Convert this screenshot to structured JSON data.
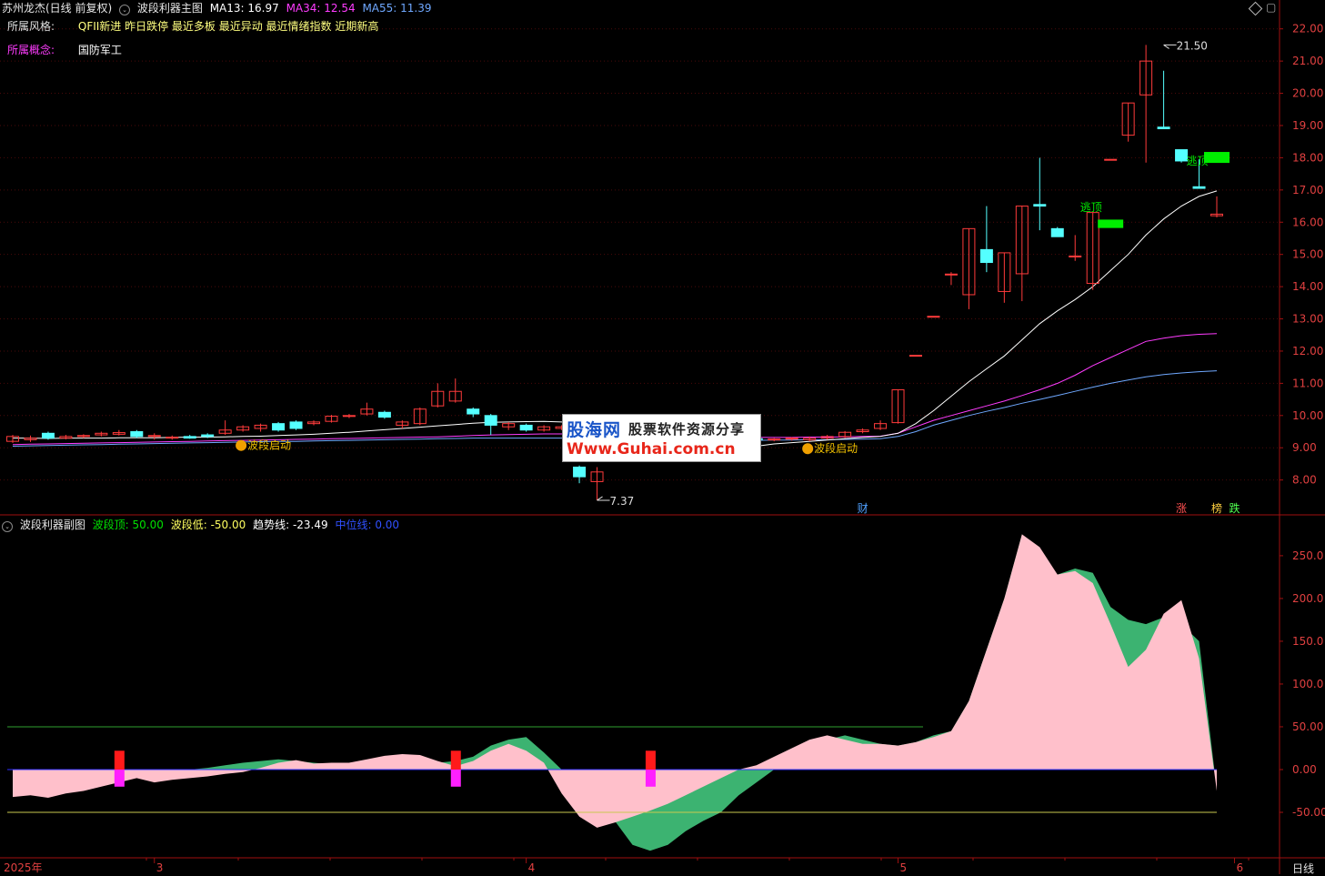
{
  "main_header": {
    "stock": "苏州龙杰(日线 前复权)",
    "indicator": "波段利器主图",
    "ma13": "MA13: 16.97",
    "ma34": "MA34: 12.54",
    "ma55": "MA55: 11.39"
  },
  "info": {
    "style_label": "所属风格:",
    "style_value": "QFII新进 昨日跌停 最近多板 最近异动 最近情绪指数 近期新高",
    "concept_label": "所属概念:",
    "concept_value": "国防军工"
  },
  "sub_header": {
    "indicator": "波段利器副图",
    "top": "波段顶: 50.00",
    "low": "波段低: -50.00",
    "trend": "趋势线: -23.49",
    "mid": "中位线: 0.00"
  },
  "logo": {
    "brand": "股海网",
    "slogan": "股票软件资源分享",
    "url": "Www.Guhai.com.cn"
  },
  "period_label": "日线",
  "colors": {
    "background": "#000000",
    "up": "#ff3b3b",
    "down": "#54ffff",
    "ma13": "#ffffff",
    "ma34": "#ff3cff",
    "ma55": "#6fa8ff",
    "pink_area": "#ffc0cb",
    "green_area": "#3cb371",
    "signal_green": "#00ee00",
    "bo_line": "#2fa02f",
    "low_line": "#c8c850",
    "mid_line": "#3030ff"
  },
  "chart_data": [
    {
      "type": "candlestick",
      "title": "波段利器主图",
      "ylim": [
        7.2,
        22.5
      ],
      "y_ticks": [
        "8.00",
        "9.00",
        "10.00",
        "11.00",
        "12.00",
        "13.00",
        "14.00",
        "15.00",
        "16.00",
        "17.00",
        "18.00",
        "19.00",
        "20.00",
        "21.00",
        "22.00"
      ],
      "x_labels": [
        "2025年",
        "3",
        "4",
        "5",
        "6"
      ],
      "x_label_index": [
        0,
        8,
        29,
        50,
        69
      ],
      "candles": [
        [
          9.2,
          9.35,
          9.15,
          9.4
        ],
        [
          9.25,
          9.3,
          9.18,
          9.38
        ],
        [
          9.45,
          9.3,
          9.25,
          9.5
        ],
        [
          9.3,
          9.35,
          9.26,
          9.4
        ],
        [
          9.35,
          9.38,
          9.3,
          9.42
        ],
        [
          9.4,
          9.45,
          9.35,
          9.5
        ],
        [
          9.42,
          9.47,
          9.38,
          9.55
        ],
        [
          9.5,
          9.35,
          9.3,
          9.55
        ],
        [
          9.35,
          9.38,
          9.25,
          9.45
        ],
        [
          9.3,
          9.33,
          9.25,
          9.38
        ],
        [
          9.35,
          9.3,
          9.28,
          9.4
        ],
        [
          9.4,
          9.35,
          9.3,
          9.45
        ],
        [
          9.45,
          9.55,
          9.4,
          9.85
        ],
        [
          9.55,
          9.65,
          9.5,
          9.7
        ],
        [
          9.6,
          9.7,
          9.5,
          9.75
        ],
        [
          9.75,
          9.55,
          9.5,
          9.8
        ],
        [
          9.8,
          9.6,
          9.55,
          9.85
        ],
        [
          9.75,
          9.8,
          9.7,
          9.85
        ],
        [
          9.82,
          9.98,
          9.78,
          10.02
        ],
        [
          9.98,
          10.0,
          9.92,
          10.05
        ],
        [
          10.05,
          10.2,
          10.0,
          10.4
        ],
        [
          10.1,
          9.95,
          9.9,
          10.15
        ],
        [
          9.7,
          9.8,
          9.6,
          9.85
        ],
        [
          9.75,
          10.2,
          9.7,
          10.25
        ],
        [
          10.3,
          10.75,
          10.25,
          11.0
        ],
        [
          10.45,
          10.75,
          10.4,
          11.15
        ],
        [
          10.2,
          10.05,
          9.95,
          10.25
        ],
        [
          10.0,
          9.7,
          9.4,
          10.05
        ],
        [
          9.65,
          9.75,
          9.55,
          9.8
        ],
        [
          9.7,
          9.55,
          9.5,
          9.75
        ],
        [
          9.55,
          9.65,
          9.5,
          9.7
        ],
        [
          9.6,
          9.65,
          9.55,
          9.7
        ],
        [
          8.4,
          8.1,
          7.9,
          8.45
        ],
        [
          7.95,
          8.25,
          7.37,
          8.4
        ],
        [
          9.3,
          9.15,
          9.1,
          9.35
        ],
        [
          9.15,
          9.2,
          9.05,
          9.25
        ],
        [
          9.25,
          9.3,
          9.15,
          9.35
        ],
        [
          9.3,
          9.25,
          9.2,
          9.35
        ],
        [
          9.28,
          9.32,
          9.22,
          9.4
        ],
        [
          9.3,
          9.35,
          9.25,
          9.4
        ],
        [
          9.35,
          9.3,
          9.25,
          9.4
        ],
        [
          9.3,
          9.28,
          9.2,
          9.35
        ],
        [
          9.28,
          9.25,
          9.2,
          9.32
        ],
        [
          9.25,
          9.27,
          9.2,
          9.3
        ],
        [
          9.27,
          9.3,
          9.22,
          9.33
        ],
        [
          9.25,
          9.3,
          9.2,
          9.35
        ],
        [
          9.3,
          9.35,
          9.25,
          9.4
        ],
        [
          9.35,
          9.48,
          9.3,
          9.52
        ],
        [
          9.5,
          9.55,
          9.45,
          9.6
        ],
        [
          9.6,
          9.75,
          9.55,
          9.85
        ],
        [
          9.78,
          10.8,
          9.75,
          10.8
        ],
        [
          11.87,
          11.87,
          11.87,
          11.87
        ],
        [
          13.08,
          13.08,
          13.08,
          13.08
        ],
        [
          14.39,
          14.39,
          14.05,
          14.45
        ],
        [
          13.75,
          15.8,
          13.3,
          15.8
        ],
        [
          15.15,
          14.75,
          14.45,
          16.5
        ],
        [
          13.85,
          15.05,
          13.5,
          15.05
        ],
        [
          14.4,
          16.5,
          13.55,
          16.5
        ],
        [
          16.55,
          16.5,
          15.75,
          18.0
        ],
        [
          15.8,
          15.55,
          15.55,
          15.85
        ],
        [
          14.95,
          14.95,
          14.8,
          15.6
        ],
        [
          14.1,
          16.3,
          13.9,
          16.3
        ],
        [
          17.95,
          17.95,
          17.95,
          17.95
        ],
        [
          18.7,
          19.7,
          18.5,
          19.7
        ],
        [
          19.95,
          21.0,
          17.85,
          21.5
        ],
        [
          18.95,
          18.9,
          18.9,
          20.7
        ],
        [
          18.25,
          17.9,
          17.85,
          18.25
        ],
        [
          17.1,
          17.05,
          17.05,
          17.95
        ],
        [
          16.2,
          16.25,
          16.15,
          16.8
        ]
      ],
      "ma13": [
        9.3,
        9.3,
        9.29,
        9.3,
        9.3,
        9.3,
        9.31,
        9.31,
        9.31,
        9.32,
        9.33,
        9.33,
        9.34,
        9.35,
        9.36,
        9.38,
        9.4,
        9.42,
        9.45,
        9.48,
        9.52,
        9.56,
        9.6,
        9.64,
        9.68,
        9.72,
        9.76,
        9.79,
        9.8,
        9.81,
        9.82,
        9.8,
        9.7,
        9.55,
        9.4,
        9.2,
        9.0,
        8.9,
        8.85,
        8.87,
        8.92,
        8.98,
        9.05,
        9.12,
        9.16,
        9.2,
        9.24,
        9.28,
        9.32,
        9.35,
        9.45,
        9.75,
        10.15,
        10.6,
        11.05,
        11.45,
        11.85,
        12.35,
        12.85,
        13.25,
        13.6,
        14.0,
        14.5,
        15.0,
        15.6,
        16.1,
        16.5,
        16.8,
        16.97
      ],
      "ma34": [
        9.1,
        9.11,
        9.12,
        9.13,
        9.14,
        9.15,
        9.16,
        9.17,
        9.18,
        9.19,
        9.2,
        9.21,
        9.22,
        9.23,
        9.24,
        9.25,
        9.26,
        9.27,
        9.28,
        9.29,
        9.3,
        9.31,
        9.32,
        9.33,
        9.34,
        9.36,
        9.38,
        9.4,
        9.41,
        9.42,
        9.43,
        9.43,
        9.42,
        9.4,
        9.38,
        9.37,
        9.36,
        9.35,
        9.34,
        9.33,
        9.32,
        9.32,
        9.32,
        9.32,
        9.32,
        9.33,
        9.33,
        9.34,
        9.35,
        9.36,
        9.45,
        9.65,
        9.85,
        10.0,
        10.15,
        10.3,
        10.45,
        10.62,
        10.8,
        11.0,
        11.25,
        11.55,
        11.8,
        12.05,
        12.3,
        12.4,
        12.48,
        12.52,
        12.54
      ],
      "ma55": [
        9.05,
        9.06,
        9.07,
        9.08,
        9.09,
        9.1,
        9.11,
        9.12,
        9.13,
        9.14,
        9.15,
        9.16,
        9.17,
        9.18,
        9.19,
        9.2,
        9.2,
        9.21,
        9.22,
        9.23,
        9.24,
        9.25,
        9.26,
        9.27,
        9.28,
        9.29,
        9.3,
        9.3,
        9.3,
        9.3,
        9.3,
        9.3,
        9.29,
        9.28,
        9.27,
        9.26,
        9.25,
        9.24,
        9.24,
        9.23,
        9.23,
        9.23,
        9.23,
        9.24,
        9.24,
        9.25,
        9.25,
        9.26,
        9.27,
        9.28,
        9.35,
        9.5,
        9.7,
        9.85,
        10.0,
        10.13,
        10.25,
        10.38,
        10.5,
        10.62,
        10.75,
        10.88,
        11.0,
        11.1,
        11.2,
        11.27,
        11.32,
        11.36,
        11.39
      ],
      "annotations": [
        {
          "index": 13,
          "price": 9.1,
          "text": "波段启动"
        },
        {
          "index": 45,
          "price": 9.0,
          "text": "波段启动"
        },
        {
          "index": 61,
          "price": 16.2,
          "text": "逃顶"
        },
        {
          "index": 67,
          "price": 17.65,
          "text": "逃顶"
        },
        {
          "index": 33,
          "price": 7.37,
          "text": "7.37",
          "kind": "min"
        },
        {
          "index": 65,
          "price": 21.5,
          "text": "21.50",
          "kind": "max"
        }
      ],
      "signal_boxes": [
        {
          "index": 62,
          "low": 15.82,
          "high": 16.08
        },
        {
          "index": 68,
          "low": 17.84,
          "high": 18.18
        }
      ],
      "event_tags": [
        {
          "index": 48,
          "text": "财"
        },
        {
          "index": 66,
          "text": "涨"
        },
        {
          "index": 68,
          "text": "榜"
        },
        {
          "index": 69,
          "text": "跌"
        }
      ]
    },
    {
      "type": "area",
      "title": "波段利器副图",
      "ylim": [
        -100,
        285
      ],
      "y_ticks": [
        "250.0",
        "200.0",
        "150.0",
        "100.0",
        "50.00",
        "0.00",
        "-50.00"
      ],
      "levels": {
        "top": 50,
        "low": -50,
        "mid": 0
      },
      "series": [
        {
          "name": "波段 (pink)",
          "values": [
            -32,
            -30,
            -33,
            -28,
            -25,
            -20,
            -15,
            -10,
            -15,
            -12,
            -10,
            -8,
            -5,
            -3,
            2,
            8,
            11,
            7,
            8,
            8,
            12,
            16,
            18,
            17,
            10,
            4,
            10,
            22,
            30,
            22,
            8,
            -28,
            -55,
            -68,
            -62,
            -55,
            -48,
            -40,
            -30,
            -20,
            -10,
            0,
            5,
            15,
            25,
            35,
            40,
            35,
            30,
            30,
            28,
            32,
            38,
            45,
            80,
            140,
            200,
            275,
            260,
            228,
            232,
            218,
            170,
            120,
            140,
            182,
            198,
            130,
            -25
          ]
        },
        {
          "name": "趋势线 (green)",
          "values": [
            -25,
            -22,
            -20,
            -18,
            -15,
            -12,
            -10,
            -8,
            -5,
            -3,
            0,
            2,
            5,
            8,
            10,
            12,
            10,
            8,
            6,
            8,
            10,
            12,
            14,
            12,
            8,
            10,
            15,
            28,
            35,
            38,
            20,
            0,
            -15,
            -35,
            -60,
            -88,
            -95,
            -88,
            -72,
            -60,
            -50,
            -30,
            -15,
            0,
            10,
            20,
            35,
            40,
            35,
            30,
            28,
            32,
            40,
            45,
            80,
            140,
            200,
            275,
            255,
            228,
            235,
            230,
            190,
            175,
            170,
            178,
            170,
            150,
            -23.49
          ]
        }
      ],
      "markers": [
        {
          "index": 6
        },
        {
          "index": 25
        },
        {
          "index": 36
        }
      ]
    }
  ]
}
